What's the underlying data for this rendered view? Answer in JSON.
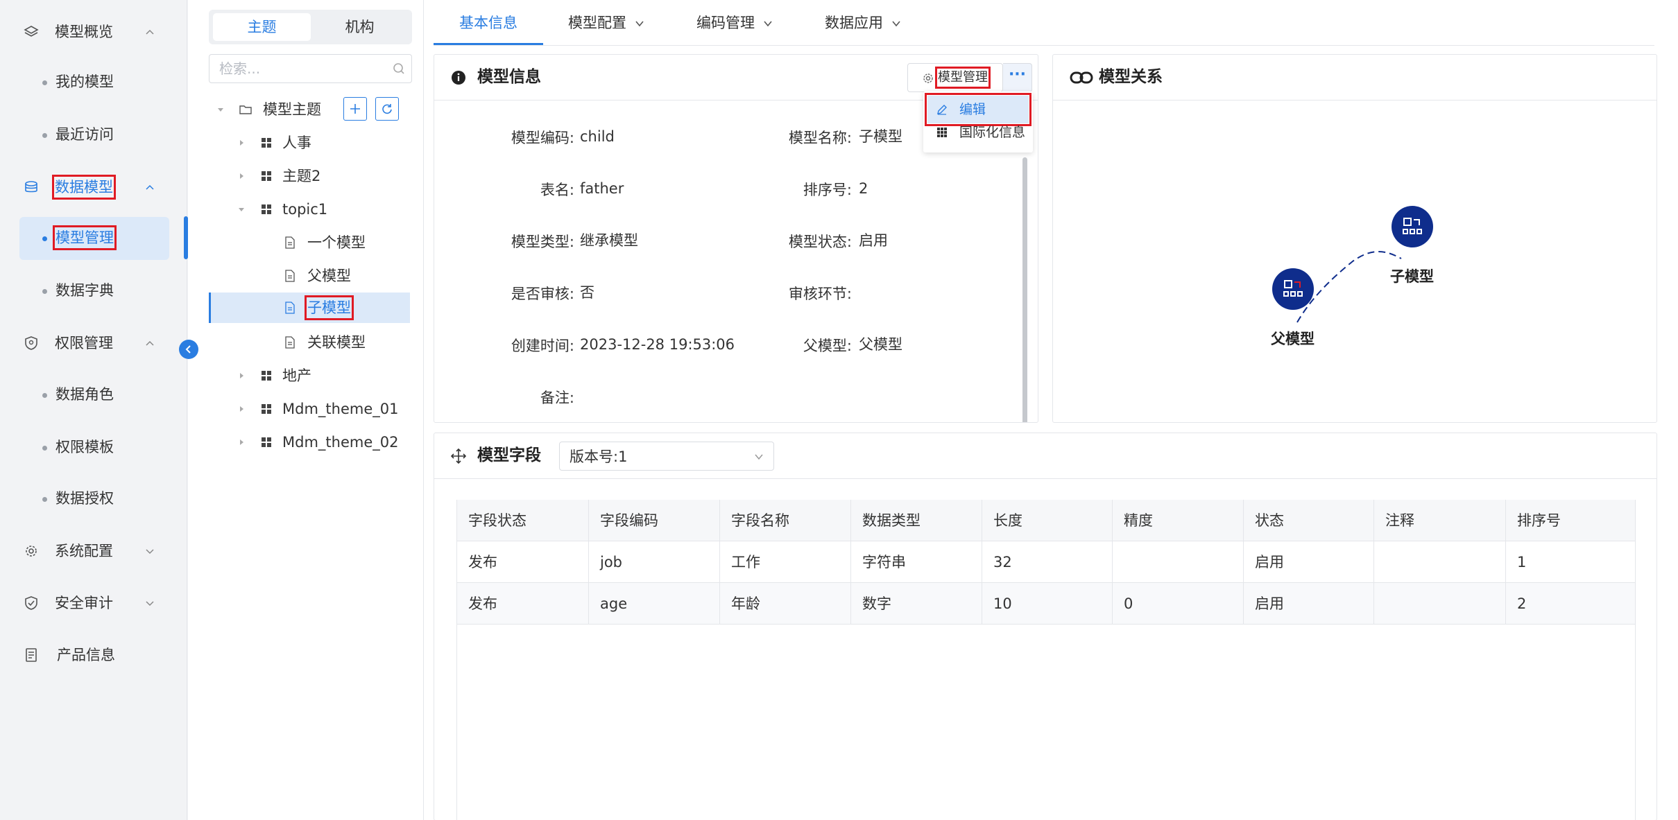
{
  "sidebar": {
    "groups": [
      {
        "label": "模型概览",
        "icon": "layers-icon",
        "expanded": true
      },
      {
        "label": "数据模型",
        "icon": "database-icon",
        "expanded": true
      },
      {
        "label": "权限管理",
        "icon": "shield-icon",
        "expanded": true
      },
      {
        "label": "系统配置",
        "icon": "gear-icon",
        "expanded": false
      },
      {
        "label": "安全审计",
        "icon": "audit-icon",
        "expanded": false
      },
      {
        "label": "产品信息",
        "icon": "document-icon",
        "expanded": false
      }
    ],
    "items": {
      "my_models": "我的模型",
      "recent": "最近访问",
      "model_management": "模型管理",
      "data_dictionary": "数据字典",
      "data_roles": "数据角色",
      "permission_templates": "权限模板",
      "data_authorization": "数据授权"
    }
  },
  "tree": {
    "tabs": [
      "主题",
      "机构"
    ],
    "active_tab": "主题",
    "search_placeholder": "检索...",
    "root": "模型主题",
    "nodes": {
      "renshi": "人事",
      "zhuti2": "主题2",
      "topic1": "topic1",
      "yige": "一个模型",
      "fu": "父模型",
      "zi": "子模型",
      "guanlian": "关联模型",
      "dichan": "地产",
      "theme01": "Mdm_theme_01",
      "theme02": "Mdm_theme_02"
    },
    "selected": "子模型"
  },
  "tabs": [
    {
      "label": "基本信息",
      "active": true
    },
    {
      "label": "模型配置",
      "active": false
    },
    {
      "label": "编码管理",
      "active": false
    },
    {
      "label": "数据应用",
      "active": false
    }
  ],
  "info": {
    "title": "模型信息",
    "manage_button": "模型管理",
    "more_button": "···",
    "dropdown": {
      "edit": "编辑",
      "i18n": "国际化信息"
    },
    "fields": {
      "code_label": "模型编码:",
      "code": "child",
      "name_label": "模型名称:",
      "name": "子模型",
      "table_label": "表名:",
      "table": "father",
      "order_label": "排序号:",
      "order": "2",
      "type_label": "模型类型:",
      "type": "继承模型",
      "status_label": "模型状态:",
      "status": "启用",
      "review_label": "是否审核:",
      "review": "否",
      "review_step_label": "审核环节:",
      "review_step": "",
      "created_label": "创建时间:",
      "created": "2023-12-28 19:53:06",
      "parent_label": "父模型:",
      "parent": "父模型",
      "remark_label": "备注:"
    }
  },
  "relation": {
    "title": "模型关系",
    "nodes": {
      "parent": "父模型",
      "child": "子模型"
    }
  },
  "fields_table": {
    "title": "模型字段",
    "version": "版本号:1",
    "columns": [
      "字段状态",
      "字段编码",
      "字段名称",
      "数据类型",
      "长度",
      "精度",
      "状态",
      "注释",
      "排序号"
    ],
    "rows": [
      [
        "发布",
        "job",
        "工作",
        "字符串",
        "32",
        "",
        "启用",
        "",
        "1"
      ],
      [
        "发布",
        "age",
        "年龄",
        "数字",
        "10",
        "0",
        "启用",
        "",
        "2"
      ]
    ]
  },
  "colors": {
    "accent": "#2a7de1",
    "highlight": "#e01b24",
    "node": "#0f2d8c"
  }
}
